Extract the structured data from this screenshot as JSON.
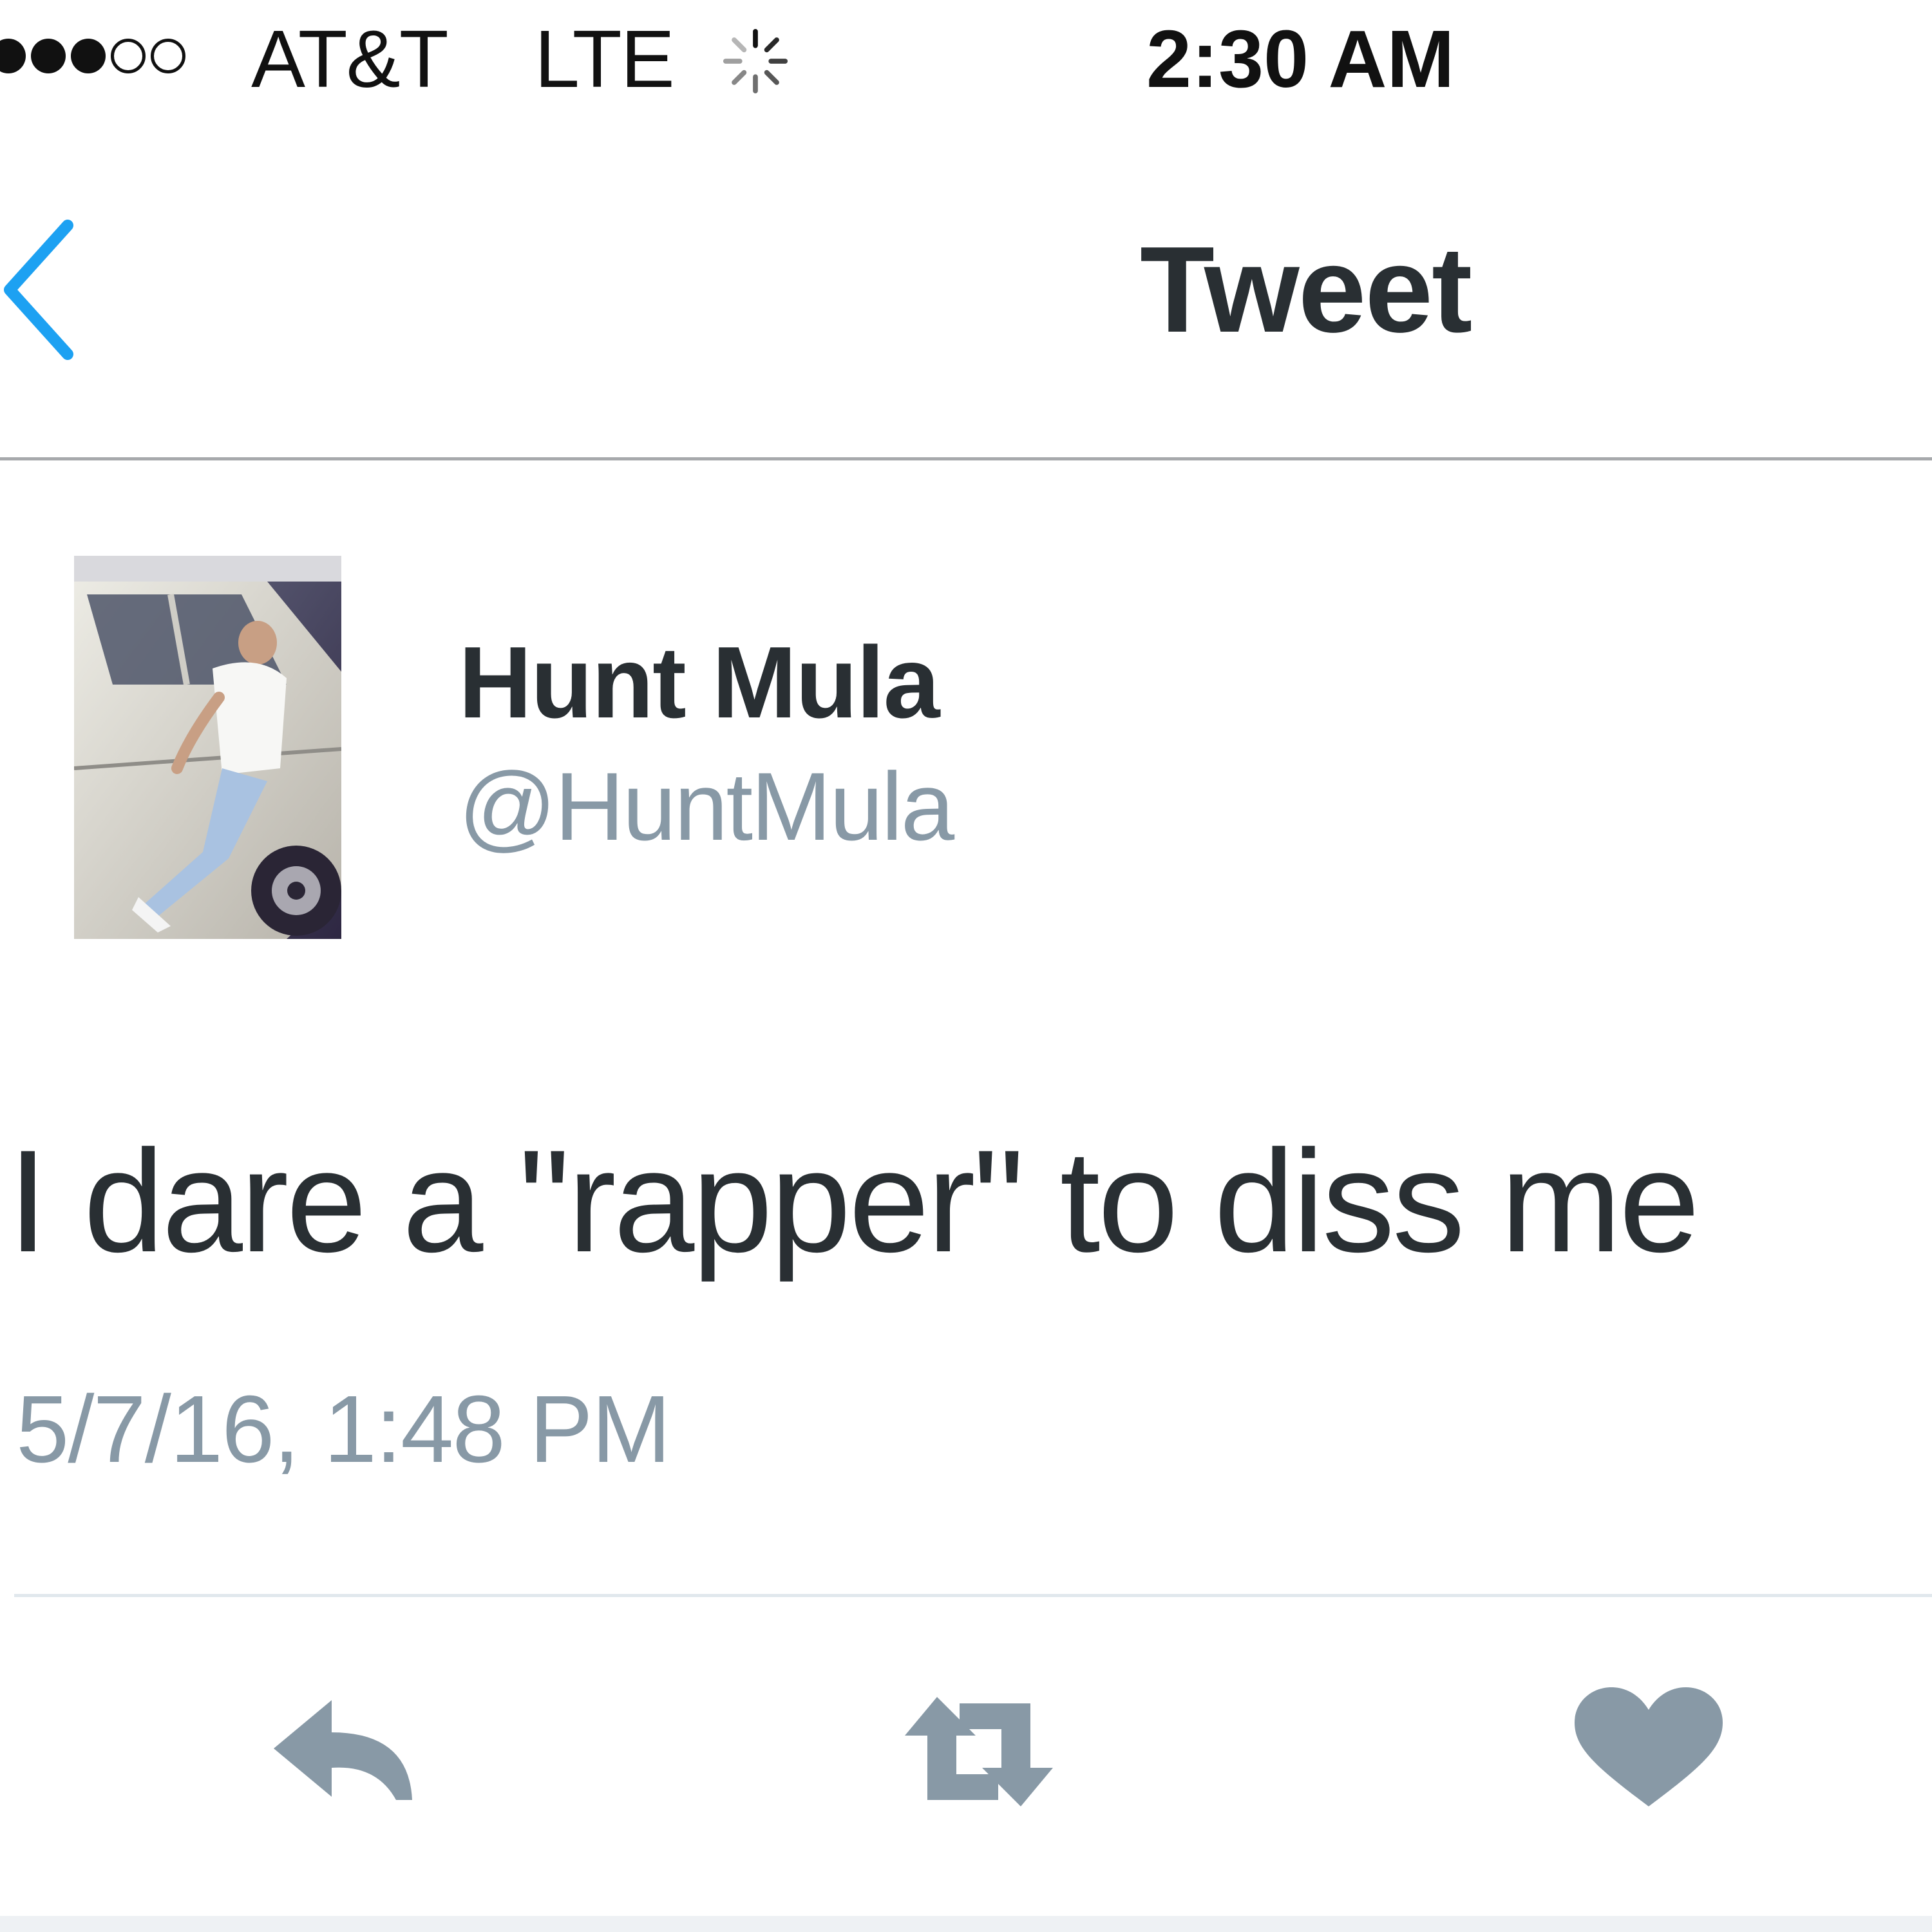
{
  "status_bar": {
    "signal_bars_filled": 3,
    "signal_bars_total": 5,
    "carrier": "AT&T",
    "network": "LTE",
    "activity_icon": "loading-spinner-icon",
    "time": "2:30 AM"
  },
  "nav_bar": {
    "back_icon": "chevron-left-icon",
    "title": "Tweet"
  },
  "tweet": {
    "author": {
      "display_name": "Hunt Mula",
      "handle": "@HuntMula",
      "avatar_icon": "profile-photo"
    },
    "text": "I dare a \"rapper\" to diss me",
    "timestamp": "5/7/16, 1:48 PM"
  },
  "actions": [
    {
      "name": "reply",
      "icon": "reply-icon"
    },
    {
      "name": "retweet",
      "icon": "retweet-icon"
    },
    {
      "name": "like",
      "icon": "heart-icon"
    }
  ],
  "colors": {
    "accent": "#1da1f2",
    "primary_text": "#292f33",
    "secondary_text": "#8899a6",
    "action_icon": "#8899a6",
    "divider": "#e1e8ed"
  }
}
